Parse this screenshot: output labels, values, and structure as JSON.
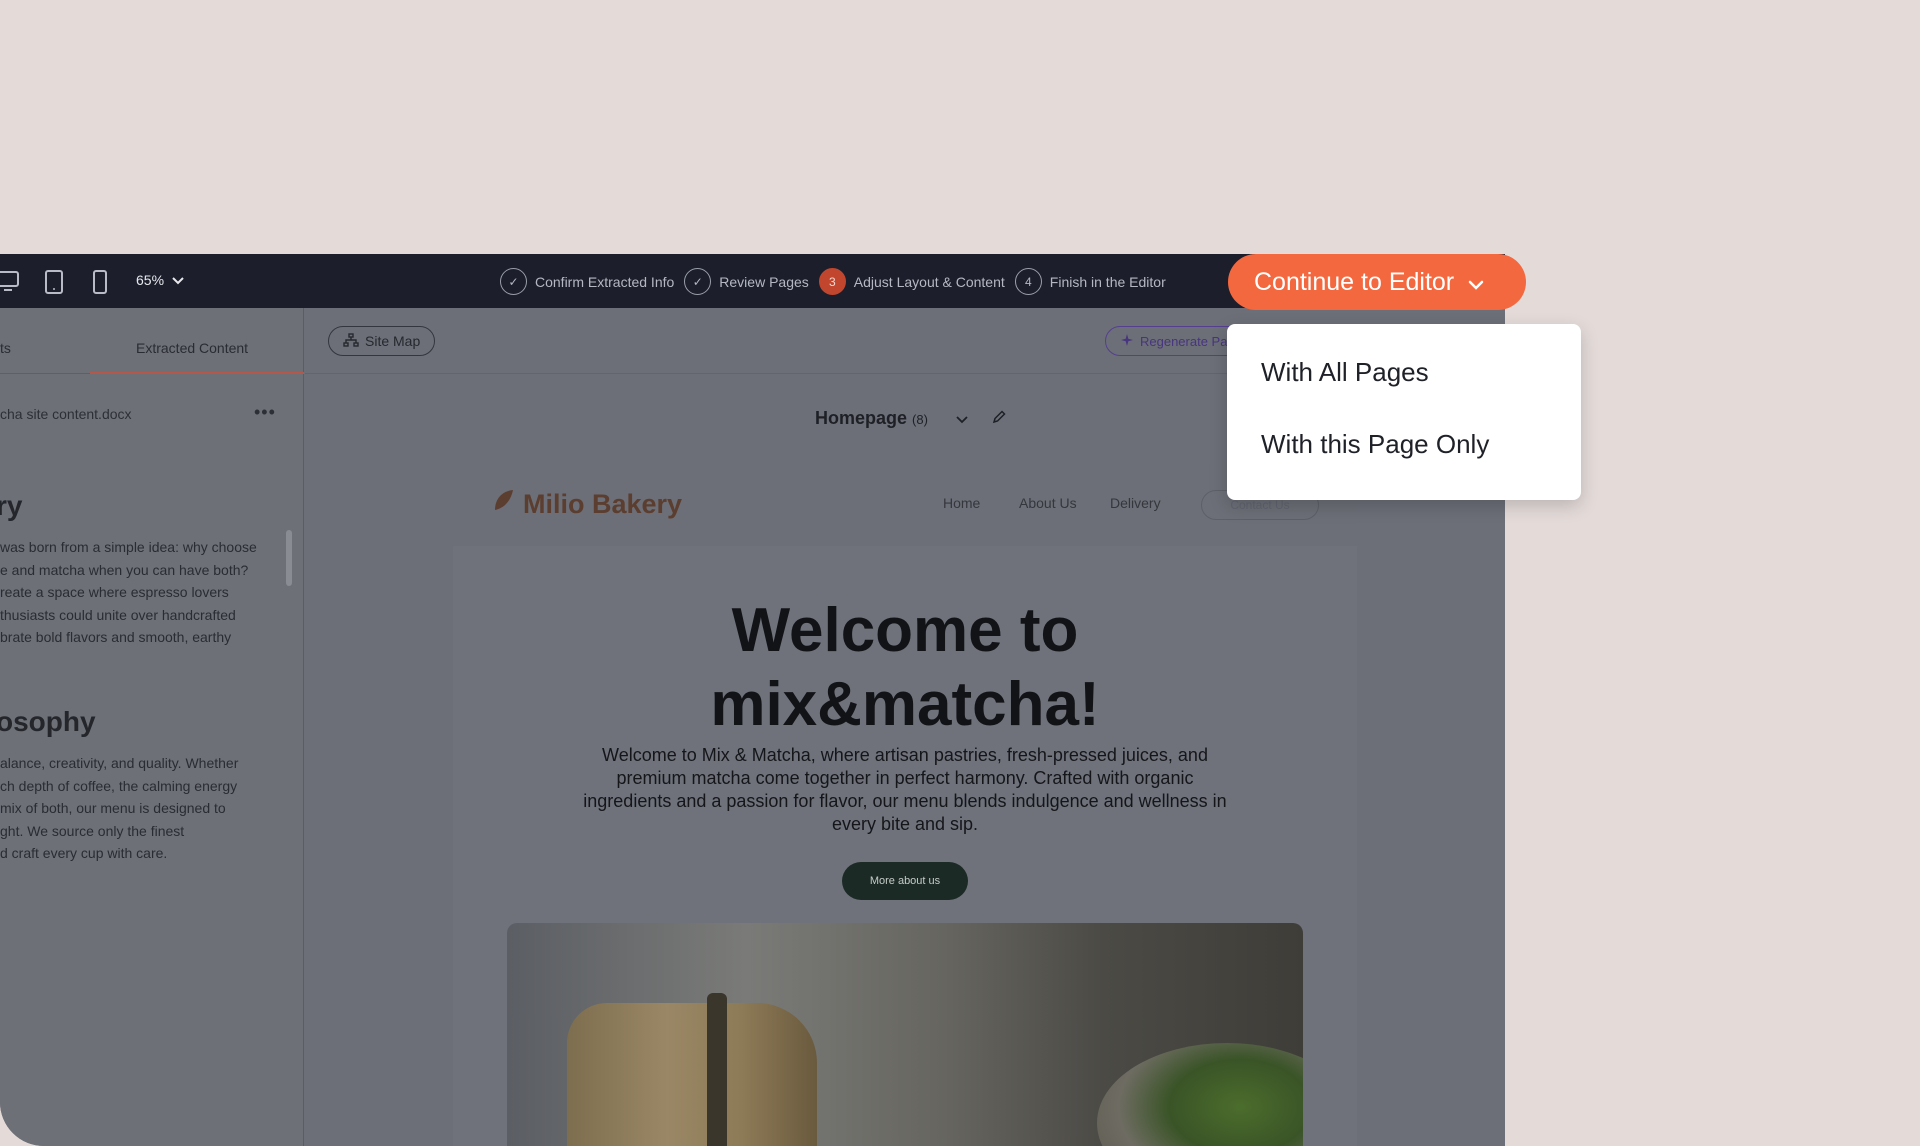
{
  "toolbar": {
    "zoom": "65%",
    "steps": [
      {
        "label": "Confirm Extracted Info",
        "marker": "✓"
      },
      {
        "label": "Review Pages",
        "marker": "✓"
      },
      {
        "label": "Adjust Layout & Content",
        "marker": "3"
      },
      {
        "label": "Finish in the Editor",
        "marker": "4"
      }
    ],
    "cta_label": "Continue to Editor"
  },
  "dropdown": {
    "items": [
      "With All Pages",
      "With this Page Only"
    ]
  },
  "left_panel": {
    "tab_left": "ts",
    "tab_right": "Extracted Content",
    "file_name": "cha site content.docx",
    "more": "•••",
    "heading1": "ry",
    "para1_lines": [
      "was born from a simple idea: why choose",
      "e and matcha when you can have both?",
      "reate a space where espresso lovers",
      "thusiasts could unite over handcrafted",
      "brate bold flavors and smooth, earthy"
    ],
    "heading2": "osophy",
    "para2_lines": [
      "alance, creativity, and quality. Whether",
      "ch depth of coffee, the calming energy",
      " mix of both, our menu is designed to",
      "ght. We source only the finest",
      "d craft every cup with care."
    ]
  },
  "subbar": {
    "site_map": "Site Map",
    "regenerate": "Regenerate Page"
  },
  "page_selector": {
    "name": "Homepage",
    "count": "(8)"
  },
  "preview": {
    "brand": "Milio Bakery",
    "nav": [
      "Home",
      "About Us",
      "Delivery"
    ],
    "nav_button": "Contact Us",
    "hero_title_line1": "Welcome to",
    "hero_title_line2": "mix&matcha!",
    "hero_text": "Welcome to Mix & Matcha, where artisan pastries, fresh-pressed juices, and premium matcha come together in perfect harmony. Crafted with organic ingredients and a passion for flavor, our menu blends indulgence and wellness in every bite and sip.",
    "hero_button": "More about us"
  },
  "colors": {
    "accent": "#f4683f",
    "topbar": "#1c1f2b",
    "background": "#e4dbd9"
  }
}
